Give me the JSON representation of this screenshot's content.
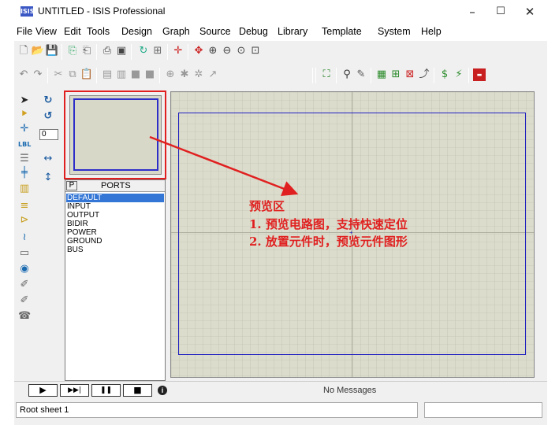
{
  "window": {
    "title": "UNTITLED - ISIS Professional",
    "icon_label": "ISIS",
    "minimize": "–",
    "maximize": "☐",
    "close": "✕"
  },
  "menu": [
    "File",
    "View",
    "Edit",
    "Tools",
    "Design",
    "Graph",
    "Source",
    "Debug",
    "Library",
    "Template",
    "System",
    "Help"
  ],
  "left_tools": {
    "rotation_value": "0"
  },
  "ports_panel": {
    "p_button": "P",
    "title": "PORTS",
    "items": [
      "DEFAULT",
      "INPUT",
      "OUTPUT",
      "BIDIR",
      "POWER",
      "GROUND",
      "BUS"
    ],
    "selected": "DEFAULT"
  },
  "annotation": {
    "heading": "预览区",
    "line1": "1. 预览电路图，支持快速定位",
    "line2": "2. 放置元件时，预览元件图形",
    "color": "#e02020"
  },
  "simulation": {
    "play": "▶",
    "step": "▶▶|",
    "pause": "❚❚",
    "stop": "■"
  },
  "status": {
    "messages": "No Messages",
    "sheet": "Root sheet 1"
  },
  "colors": {
    "sheet_border": "#2020c0",
    "canvas_bg": "#dcdccc",
    "selected": "#3476d6"
  }
}
